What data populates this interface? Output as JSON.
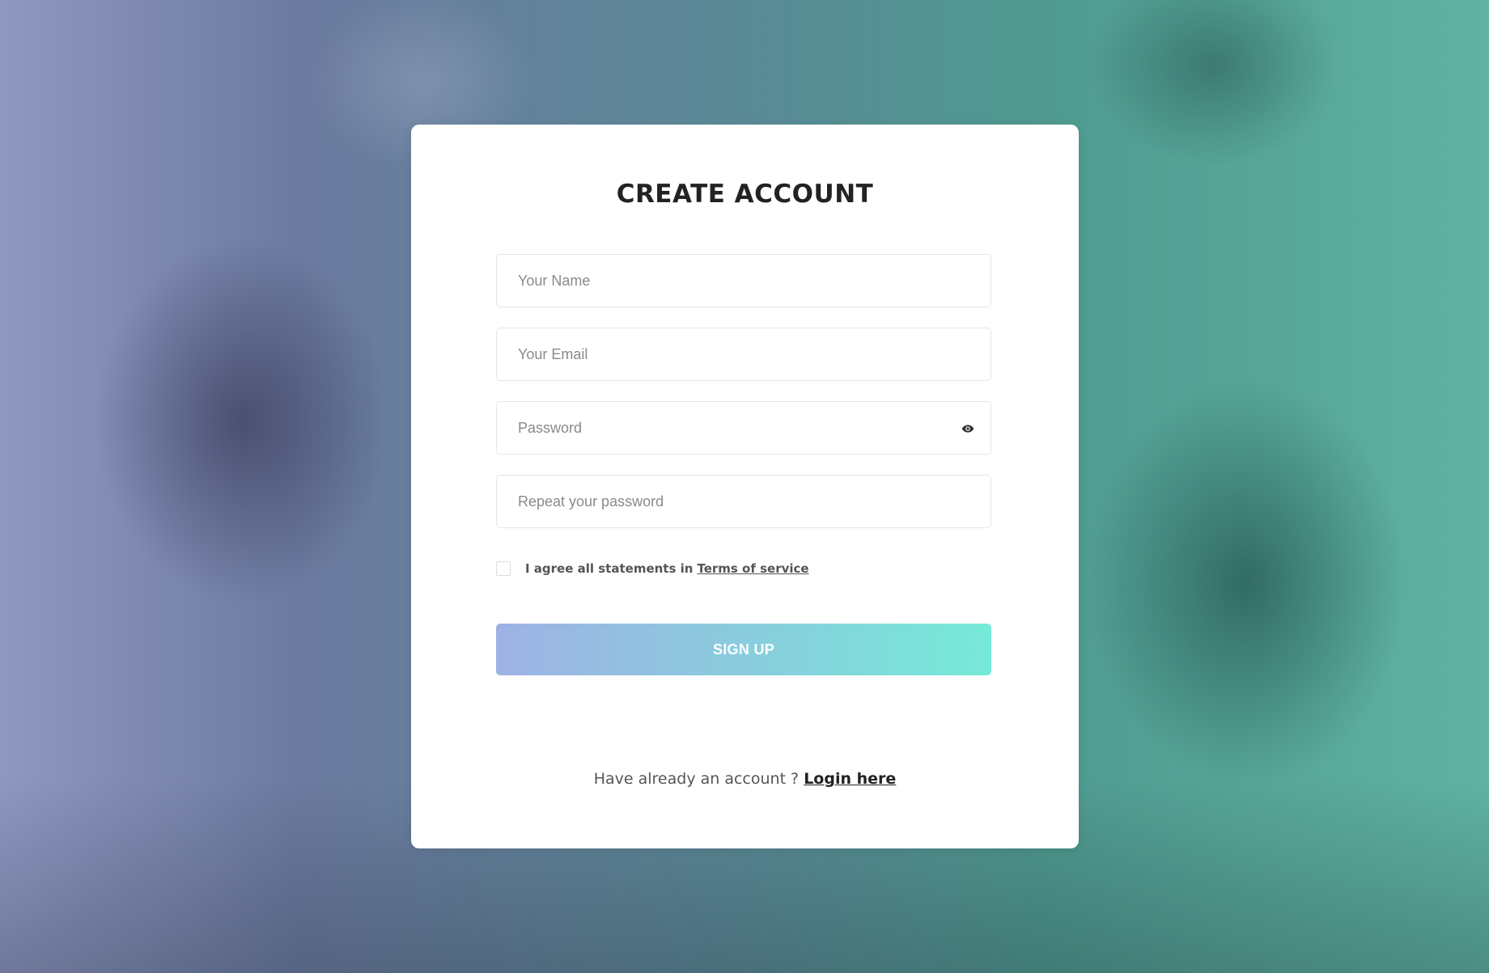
{
  "colors": {
    "background_gradient_start": "#8f97c2",
    "background_gradient_end": "#5fb3a1",
    "button_gradient_start": "#9eb2e4",
    "button_gradient_end": "#76ead8",
    "card": "#ffffff",
    "title": "#222222"
  },
  "form": {
    "title": "CREATE ACCOUNT",
    "fields": {
      "name": {
        "placeholder": "Your Name",
        "value": ""
      },
      "email": {
        "placeholder": "Your Email",
        "value": ""
      },
      "password": {
        "placeholder": "Password",
        "value": "",
        "icon": "eye-icon"
      },
      "repeat_password": {
        "placeholder": "Repeat your password",
        "value": ""
      }
    },
    "agree": {
      "checked": false,
      "text": "I agree all statements in",
      "link_text": "Terms of service"
    },
    "submit_label": "SIGN UP",
    "login": {
      "prompt": "Have already an account ?",
      "link_text": "Login here"
    }
  }
}
